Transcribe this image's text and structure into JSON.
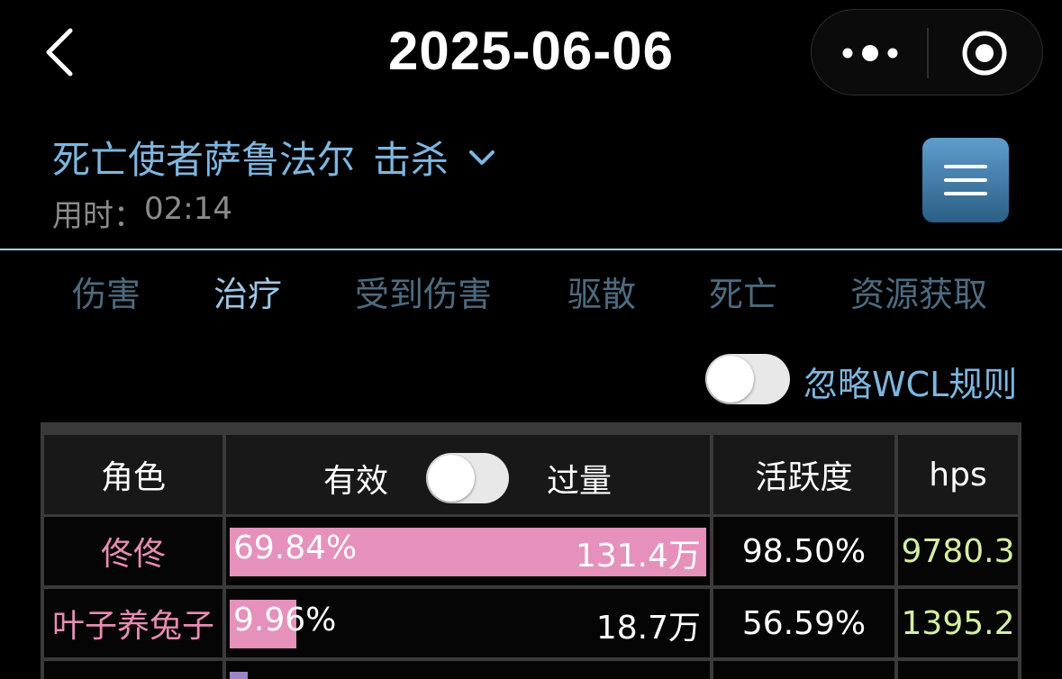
{
  "nav": {
    "title": "2025-06-06",
    "back_icon": "chevron-left-icon",
    "more_icon": "more-dots-icon",
    "close_icon": "target-circle-icon"
  },
  "encounter": {
    "boss_name": "死亡使者萨鲁法尔",
    "result": "击杀",
    "duration_label": "用时：",
    "duration_value": "02:14",
    "menu_icon": "hamburger-menu-icon"
  },
  "tabs": [
    {
      "label": "伤害",
      "active": false
    },
    {
      "label": "治疗",
      "active": true
    },
    {
      "label": "受到伤害",
      "active": false
    },
    {
      "label": "驱散",
      "active": false
    },
    {
      "label": "死亡",
      "active": false
    },
    {
      "label": "资源获取",
      "active": false
    }
  ],
  "ignore_rule": {
    "label": "忽略WCL规则",
    "on": false
  },
  "table": {
    "headers": {
      "role": "角色",
      "effective": "有效",
      "overheal": "过量",
      "activity": "活跃度",
      "hps": "hps"
    },
    "overheal_toggle_on": false,
    "rows": [
      {
        "name": "佟佟",
        "share": "69.84%",
        "share_value": 1.0,
        "amount": "131.4万",
        "activity": "98.50%",
        "hps": "9780.3"
      },
      {
        "name": "叶子养兔子",
        "share": "9.96%",
        "share_value": 0.14,
        "amount": "18.7万",
        "activity": "56.59%",
        "hps": "1395.2"
      }
    ]
  },
  "colors": {
    "accent_blue": "#7eb6df",
    "tab_inactive": "#4d6b80",
    "name_pink": "#e88cb4",
    "bar_pink": "#e591bb",
    "hps_green": "#d4f0a0"
  }
}
